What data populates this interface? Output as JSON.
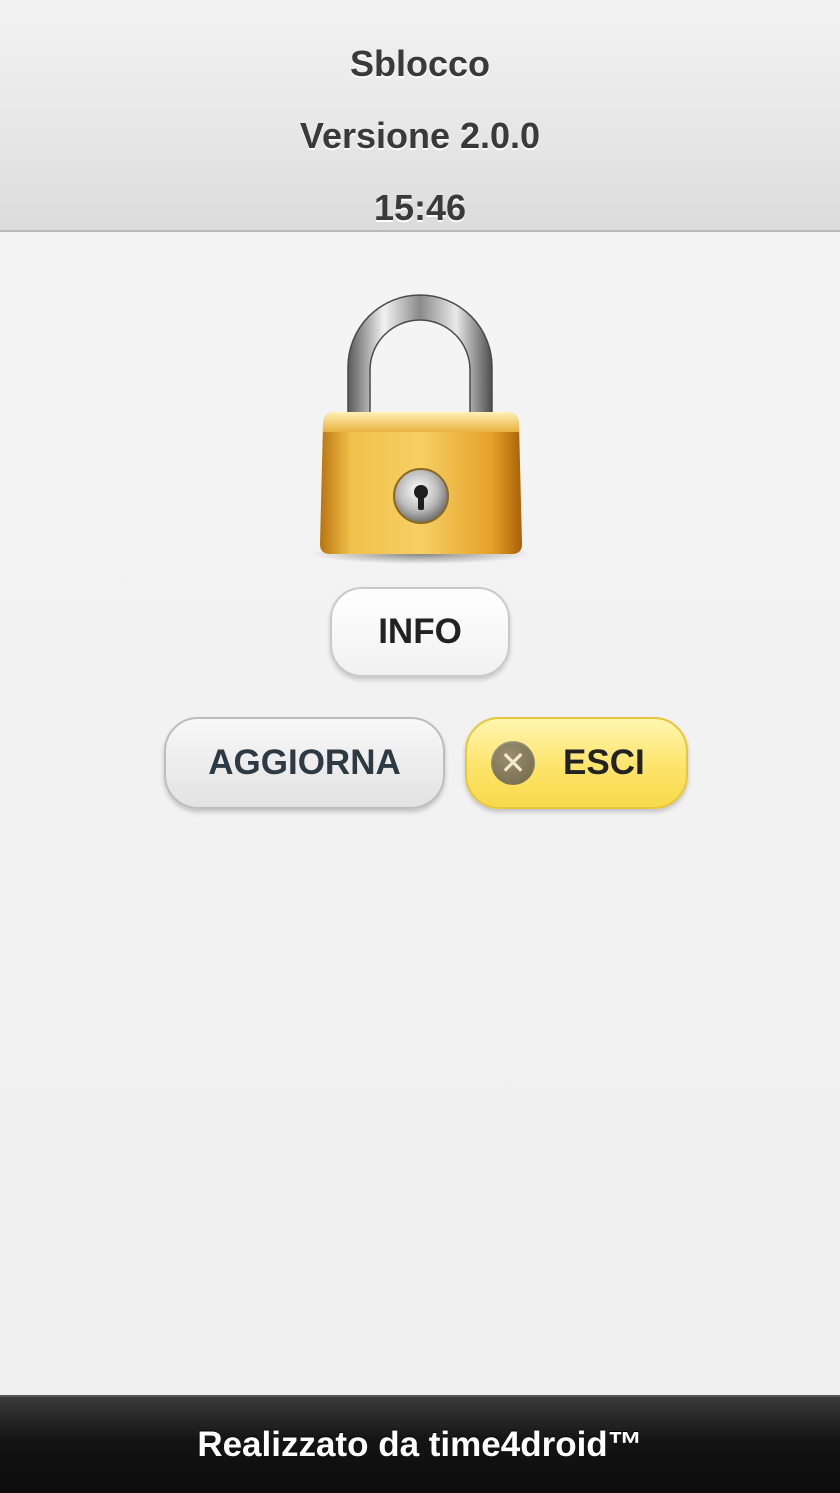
{
  "header": {
    "title": "Sblocco",
    "version": "Versione 2.0.0",
    "time": "15:46"
  },
  "main": {
    "lock_icon": "padlock-icon",
    "info_label": "INFO",
    "aggiorna_label": "AGGIORNA",
    "esci_label": "ESCI",
    "esci_icon": "close-icon",
    "esci_icon_glyph": "✕"
  },
  "footer": {
    "credit": "Realizzato da time4droid™"
  },
  "colors": {
    "accent_yellow": "#fde46a",
    "footer_bg": "#141414",
    "lock_gold": "#e0a227"
  }
}
